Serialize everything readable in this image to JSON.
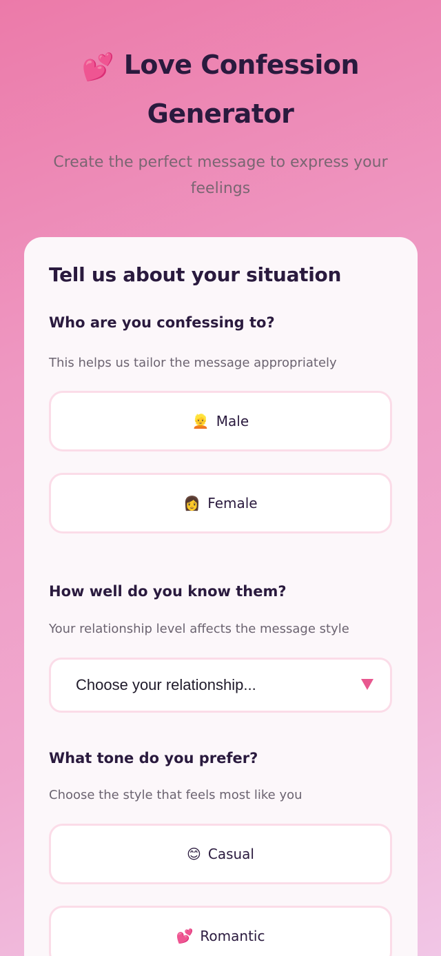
{
  "header": {
    "emoji": "💕",
    "title": "Love Confession Generator",
    "subtitle": "Create the perfect message to express your feelings"
  },
  "card": {
    "title": "Tell us about your situation",
    "gender": {
      "question": "Who are you confessing to?",
      "help": "This helps us tailor the message appropriately",
      "options": [
        {
          "emoji": "👱",
          "label": "Male"
        },
        {
          "emoji": "👩",
          "label": "Female"
        }
      ]
    },
    "relationship": {
      "question": "How well do you know them?",
      "help": "Your relationship level affects the message style",
      "placeholder": "Choose your relationship..."
    },
    "tone": {
      "question": "What tone do you prefer?",
      "help": "Choose the style that feels most like you",
      "options": [
        {
          "emoji": "😊",
          "label": "Casual"
        },
        {
          "emoji": "💕",
          "label": "Romantic"
        }
      ]
    }
  }
}
